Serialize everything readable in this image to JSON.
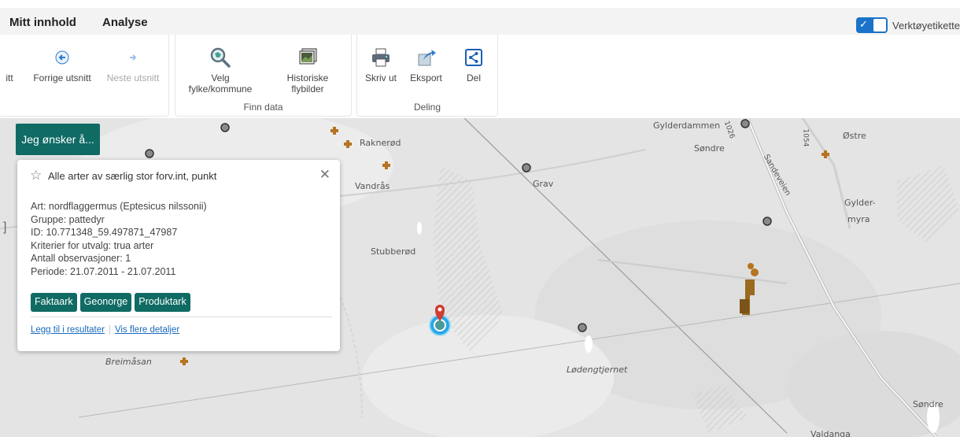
{
  "tabs": [
    {
      "label": "Mitt innhold"
    },
    {
      "label": "Analyse"
    }
  ],
  "tooltip_toggle": {
    "label": "Verktøyetikette",
    "checked": true
  },
  "ribbon": {
    "nav": {
      "partial_label": "itt",
      "prev_label": "Forrige utsnitt",
      "next_label": "Neste utsnitt"
    },
    "finn_data": {
      "group_label": "Finn data",
      "velg_line1": "Velg",
      "velg_line2": "fylke/kommune",
      "hist_line1": "Historiske",
      "hist_line2": "flybilder"
    },
    "deling": {
      "group_label": "Deling",
      "print_label": "Skriv ut",
      "export_label": "Eksport",
      "share_label": "Del"
    }
  },
  "jeg_button": "Jeg ønsker å...",
  "popup": {
    "title": "Alle arter av særlig stor forv.int, punkt",
    "attributes": [
      "Art: nordflaggermus (Eptesicus nilssonii)",
      "Gruppe: pattedyr",
      "ID: 10.771348_59.497871_47987",
      "Kriterier for utvalg: trua arter",
      "Antall observasjoner: 1",
      "Periode: 21.07.2011 - 21.07.2011"
    ],
    "buttons": [
      "Faktaark",
      "Geonorge",
      "Produktark"
    ],
    "links": [
      "Legg til i resultater",
      "Vis flere detaljer"
    ]
  },
  "map": {
    "places": [
      "Gylderdammen",
      "Søndre",
      "Østre",
      "Gylder-",
      "myra",
      "Raknerød",
      "Grav",
      "Vandrås",
      "Stubberød",
      "Breimåsan",
      "Lødengtjernet",
      "Søndre",
      "Valdanga",
      "Sandeveien",
      "1054",
      "1026"
    ]
  },
  "colors": {
    "accent": "#0f6b64",
    "link": "#1a6bbd",
    "toggle": "#1a73c8"
  }
}
